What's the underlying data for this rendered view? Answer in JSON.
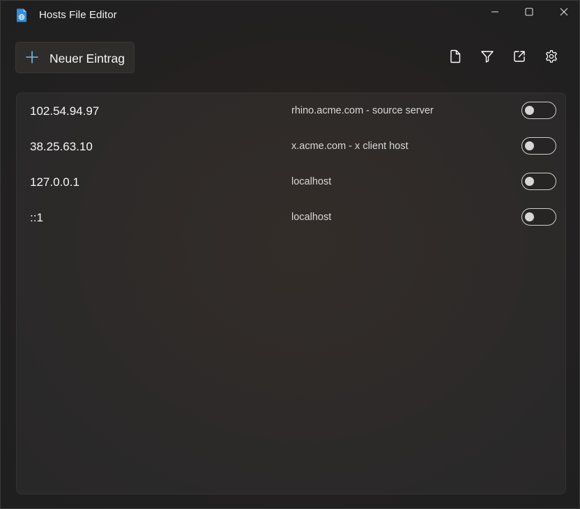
{
  "app": {
    "title": "Hosts File Editor",
    "icon": "hosts-file-document-icon",
    "accent": "#2f8fde"
  },
  "window_controls": {
    "minimize": "minimize-icon",
    "maximize": "maximize-icon",
    "close": "close-icon"
  },
  "toolbar": {
    "new_entry_label": "Neuer Eintrag",
    "new_entry_icon": "plus-icon",
    "actions": [
      "file-icon",
      "filter-icon",
      "open-external-icon",
      "gear-icon"
    ]
  },
  "entries": [
    {
      "address": "102.54.94.97",
      "host": "rhino.acme.com - source server",
      "active": false
    },
    {
      "address": "38.25.63.10",
      "host": "x.acme.com - x client host",
      "active": false
    },
    {
      "address": "127.0.0.1",
      "host": "localhost",
      "active": false
    },
    {
      "address": "::1",
      "host": "localhost",
      "active": false
    }
  ]
}
